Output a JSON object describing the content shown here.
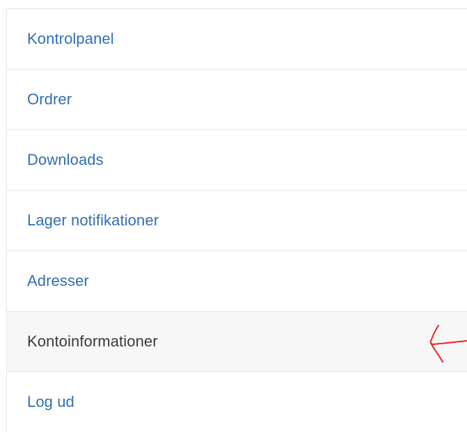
{
  "account_nav": {
    "items": [
      {
        "label": "Kontrolpanel",
        "active": false
      },
      {
        "label": "Ordrer",
        "active": false
      },
      {
        "label": "Downloads",
        "active": false
      },
      {
        "label": "Lager notifikationer",
        "active": false
      },
      {
        "label": "Adresser",
        "active": false
      },
      {
        "label": "Kontoinformationer",
        "active": true
      },
      {
        "label": "Log ud",
        "active": false
      }
    ]
  },
  "colors": {
    "link": "#2f6eb5",
    "active_text": "#3a3a3a",
    "active_bg": "#f7f7f7",
    "border": "#e6e6e6",
    "annotation": "#e8231d"
  },
  "annotation": {
    "icon": "hand-drawn-arrow-icon",
    "points_to": "Kontoinformationer"
  }
}
